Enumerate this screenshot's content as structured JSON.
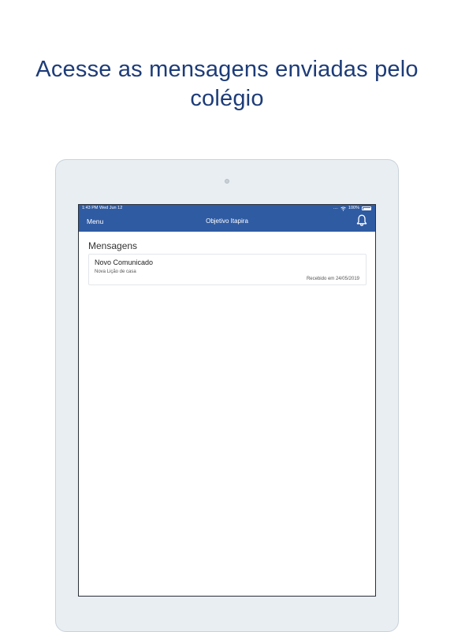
{
  "headline": {
    "line1": "Acesse as mensagens enviadas pelo",
    "line2": "colégio"
  },
  "device": {
    "status_bar": {
      "time_date": "1:43 PM   Wed Jun 12",
      "signal_dots": "....",
      "battery": "100%",
      "wifi_icon": "wifi-icon",
      "battery_icon": "battery-icon"
    },
    "app_bar": {
      "menu_label": "Menu",
      "title": "Objetivo Itapira",
      "notification_icon": "bell-icon",
      "background_color": "#2f5ba3"
    },
    "section_title": "Mensagens",
    "messages": [
      {
        "title": "Novo Comunicado",
        "subtitle": "Nova Lição de casa",
        "received": "Recebido em 24/05/2019"
      }
    ]
  },
  "colors": {
    "headline": "#1d3c78",
    "accent": "#2f5ba3",
    "device_frame": "#e9eef2"
  }
}
